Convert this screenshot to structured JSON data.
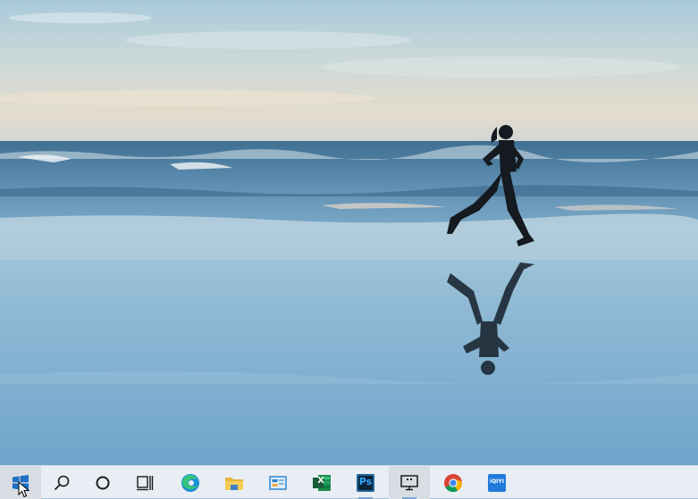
{
  "wallpaper": {
    "scene": "runner-on-beach",
    "colors": {
      "sky_top": "#b6d3e2",
      "sky_low": "#dcd8cc",
      "sea": "#4d7fa3",
      "sand": "#86b4d2"
    }
  },
  "taskbar": {
    "background": "#e8eef4",
    "items": [
      {
        "name": "start-button",
        "icon": "windows-logo-icon",
        "active": true
      },
      {
        "name": "search-button",
        "icon": "search-icon"
      },
      {
        "name": "cortana-button",
        "icon": "circle-icon"
      },
      {
        "name": "task-view-button",
        "icon": "task-view-icon"
      },
      {
        "name": "taskbar-app-edge",
        "icon": "edge-icon"
      },
      {
        "name": "taskbar-app-file-explorer",
        "icon": "folder-icon"
      },
      {
        "name": "taskbar-app-control-panel",
        "icon": "control-panel-icon"
      },
      {
        "name": "taskbar-app-excel",
        "icon": "excel-icon",
        "label": "X"
      },
      {
        "name": "taskbar-app-photoshop",
        "icon": "photoshop-icon",
        "label": "Ps"
      },
      {
        "name": "taskbar-app-remote-desktop",
        "icon": "monitor-icon",
        "active": true
      },
      {
        "name": "taskbar-app-chrome",
        "icon": "chrome-icon"
      },
      {
        "name": "taskbar-app-iqiyi",
        "icon": "iqiyi-icon",
        "label": "iQIYI"
      }
    ]
  }
}
